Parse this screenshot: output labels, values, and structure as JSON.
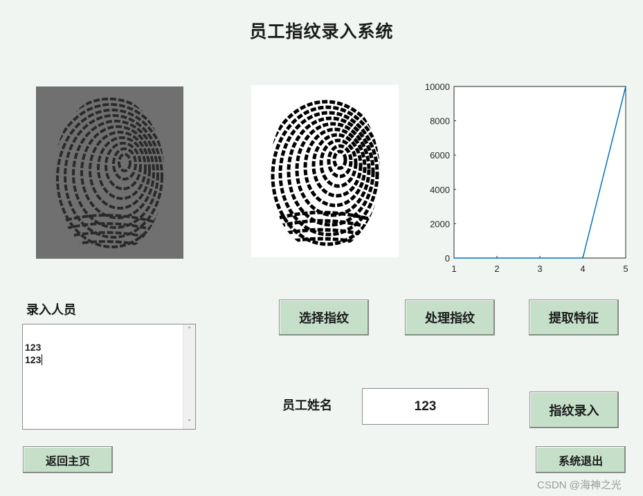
{
  "title": "员工指纹录入系统",
  "buttons": {
    "select": "选择指纹",
    "process": "处理指纹",
    "extract": "提取特征",
    "enroll": "指纹录入",
    "home": "返回主页",
    "exit": "系统退出"
  },
  "entered_label": "录入人员",
  "entered_list": [
    "123",
    "123"
  ],
  "employee_name_label": "员工姓名",
  "employee_name_value": "123",
  "watermark": "CSDN @海神之光",
  "chart_data": {
    "type": "line",
    "x": [
      1,
      2,
      3,
      4,
      5
    ],
    "series": [
      {
        "values": [
          0,
          0,
          0,
          0,
          10000
        ]
      }
    ],
    "xlim": [
      1,
      5
    ],
    "ylim": [
      0,
      10000
    ],
    "xticks": [
      "1",
      "2",
      "3",
      "4",
      "5"
    ],
    "yticks": [
      "0",
      "2000",
      "4000",
      "6000",
      "8000",
      "10000"
    ],
    "grid": false,
    "line_color": "#0072BD"
  }
}
